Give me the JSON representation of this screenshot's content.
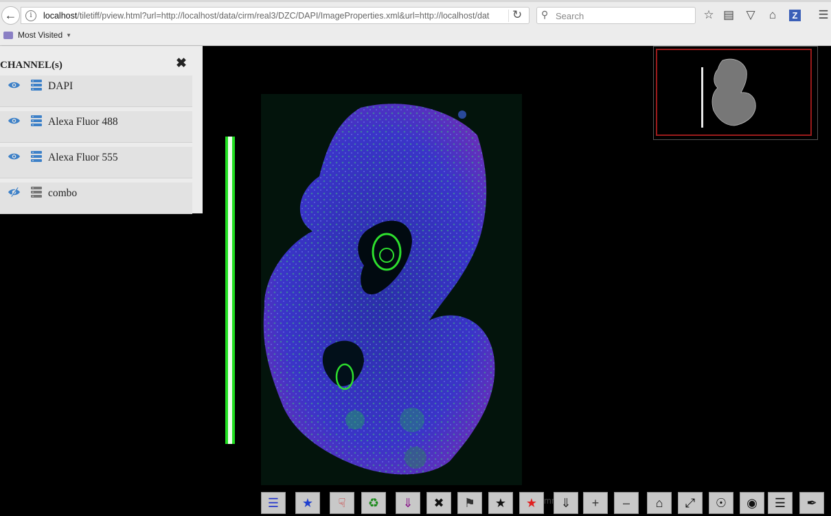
{
  "browser": {
    "url_host": "localhost",
    "url_rest": "/tiletiff/pview.html?url=http://localhost/data/cirm/real3/DZC/DAPI/ImageProperties.xml&url=http://localhost/dat",
    "search_placeholder": "Search",
    "bookmarks_label": "Most Visited",
    "zotero_label": "Z"
  },
  "panel": {
    "title": "CHANNEL(s)",
    "channels": [
      {
        "name": "DAPI",
        "visible": true
      },
      {
        "name": "Alexa Fluor 488",
        "visible": true
      },
      {
        "name": "Alexa Fluor 555",
        "visible": true
      },
      {
        "name": "combo",
        "visible": false
      }
    ]
  },
  "viewer": {
    "scale_label": "mm"
  },
  "toolbar": {
    "buttons": [
      {
        "icon": "layers-icon",
        "color": "#2233cc"
      },
      {
        "icon": "star-icon",
        "color": "#1f3fcf"
      },
      {
        "icon": "hand-pointer-icon",
        "color": "#cc2222"
      },
      {
        "icon": "recycle-hand-icon",
        "color": "#1a8a1a"
      },
      {
        "icon": "download-circle-icon",
        "color": "#8a1a8a"
      },
      {
        "icon": "close-icon",
        "color": "#111111"
      },
      {
        "icon": "tag-icon",
        "color": "#333333"
      },
      {
        "icon": "star-outline-icon",
        "color": "#111111"
      },
      {
        "icon": "star-red-icon",
        "color": "#e02020"
      },
      {
        "icon": "download-icon",
        "color": "#333333"
      },
      {
        "icon": "zoom-in-icon",
        "color": "#333333"
      },
      {
        "icon": "zoom-out-icon",
        "color": "#333333"
      },
      {
        "icon": "home-icon",
        "color": "#111111"
      },
      {
        "icon": "fullscreen-icon",
        "color": "#111111"
      },
      {
        "icon": "target-icon",
        "color": "#111111"
      },
      {
        "icon": "eye-icon",
        "color": "#111111"
      },
      {
        "icon": "menu-icon",
        "color": "#111111"
      },
      {
        "icon": "quill-icon",
        "color": "#111111"
      }
    ]
  }
}
